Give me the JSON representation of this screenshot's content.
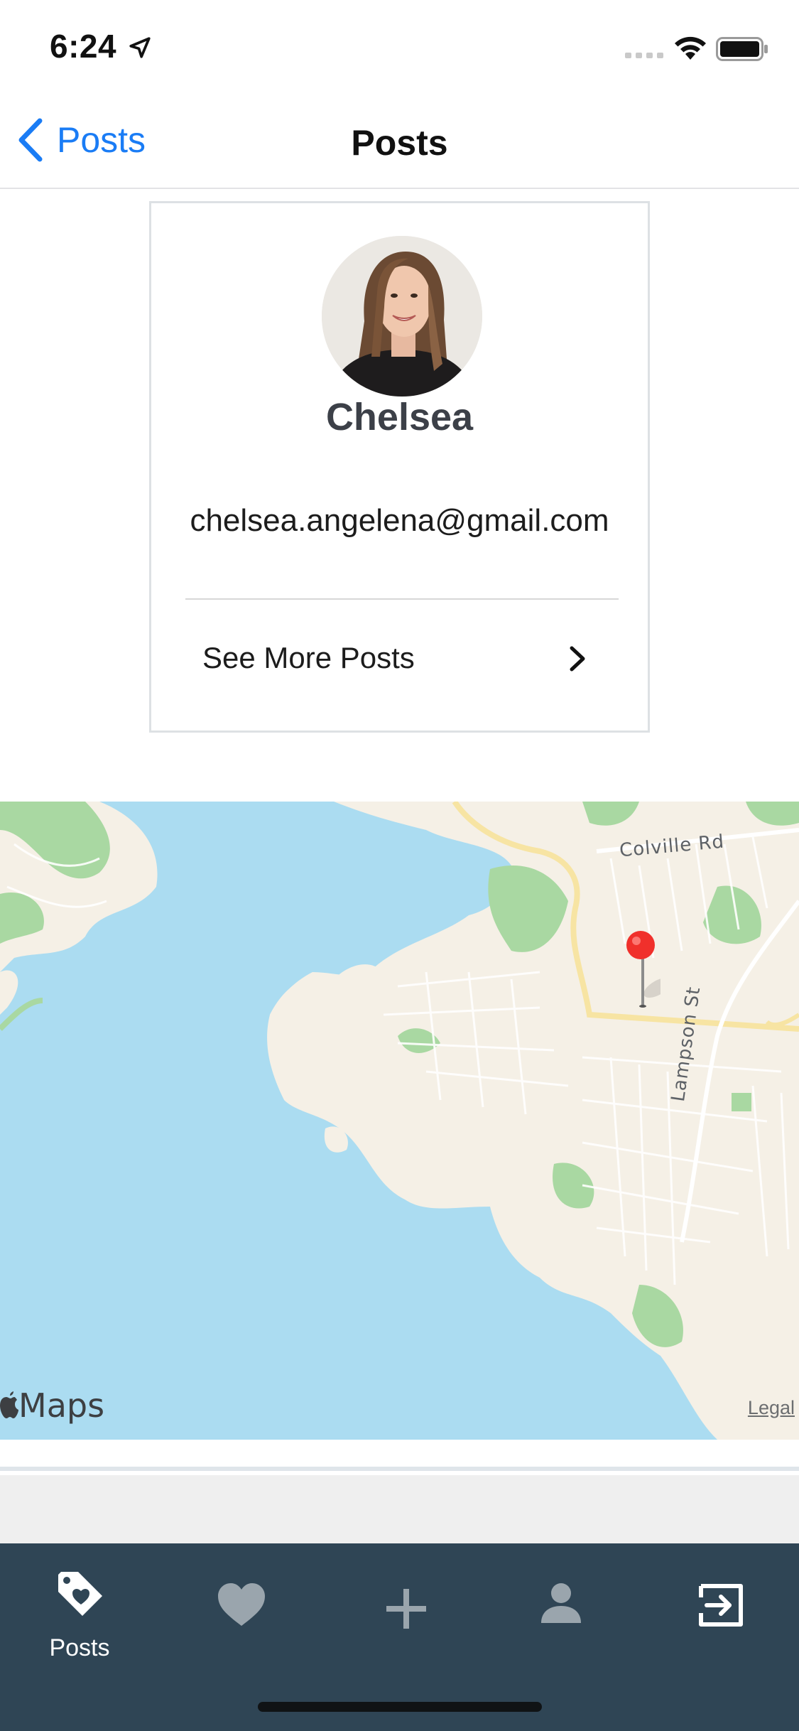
{
  "status_bar": {
    "time": "6:24",
    "icons": [
      "location-arrow-icon",
      "cellular-signal-icon",
      "wifi-icon",
      "battery-icon"
    ]
  },
  "nav": {
    "back_label": "Posts",
    "title": "Posts",
    "accent_color": "#1a7cf5"
  },
  "profile": {
    "name": "Chelsea",
    "email": "chelsea.angelena@gmail.com",
    "see_more_label": "See More Posts"
  },
  "map": {
    "roads": [
      "Colville Rd",
      "Lampson St"
    ],
    "logo_text": "Maps",
    "legal_label": "Legal",
    "water_color": "#abdcf1",
    "land_color": "#f5f0e6",
    "park_color": "#a9d8a2",
    "pin_color": "#f0302b"
  },
  "tab_bar": {
    "background": "#2f4555",
    "tabs": [
      {
        "icon": "tag-heart-icon",
        "label": "Posts",
        "active": true
      },
      {
        "icon": "heart-icon",
        "label": ""
      },
      {
        "icon": "plus-icon",
        "label": ""
      },
      {
        "icon": "person-icon",
        "label": ""
      },
      {
        "icon": "logout-icon",
        "label": ""
      }
    ]
  }
}
